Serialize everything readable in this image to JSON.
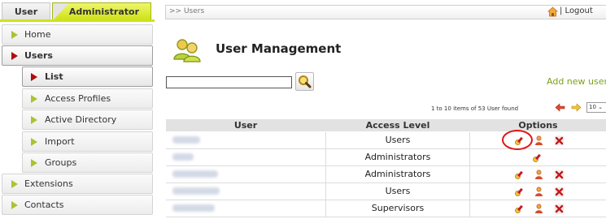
{
  "sidebar": {
    "role_tabs": {
      "user": "User",
      "administrator": "Administrator"
    },
    "items": [
      {
        "label": "Home",
        "active": false
      },
      {
        "label": "Users",
        "active": true
      },
      {
        "label": "List",
        "active": true
      },
      {
        "label": "Access Profiles",
        "active": false
      },
      {
        "label": "Active Directory",
        "active": false
      },
      {
        "label": "Import",
        "active": false
      },
      {
        "label": "Groups",
        "active": false
      },
      {
        "label": "Extensions",
        "active": false
      },
      {
        "label": "Contacts",
        "active": false
      }
    ]
  },
  "topbar": {
    "breadcrumb": ">> Users",
    "logout": "| Logout"
  },
  "page": {
    "title": "User Management",
    "add_user_link": "Add new user",
    "search": {
      "value": "",
      "placeholder": ""
    }
  },
  "pagination": {
    "text": "1 to 10 items of 53 User found",
    "per_page": "10"
  },
  "table": {
    "headers": {
      "user": "User",
      "access_level": "Access Level",
      "options": "Options"
    },
    "rows": [
      {
        "access_level": "Users"
      },
      {
        "access_level": "Administrators"
      },
      {
        "access_level": "Administrators"
      },
      {
        "access_level": "Users"
      },
      {
        "access_level": "Supervisors"
      }
    ]
  },
  "colors": {
    "accent_green": "#cfe21b",
    "link_green": "#7aa21a",
    "active_marker": "#b00d0d",
    "highlight": "#e31212"
  }
}
